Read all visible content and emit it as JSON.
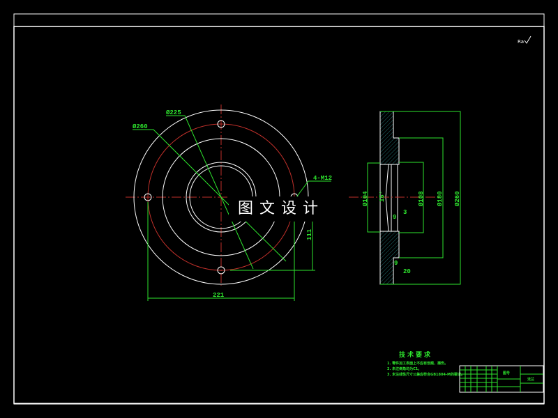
{
  "colors": {
    "background": "#000000",
    "outline": "#ffffff",
    "dimension": "#2ee62e",
    "centerline": "#c0302a"
  },
  "front_view": {
    "dims": {
      "d_outer": "Ø260",
      "d_bolt": "Ø225",
      "holes": "4-M12",
      "height": "111",
      "width": "221"
    }
  },
  "side_view": {
    "dims": {
      "d_bore": "Ø104",
      "angle": "15°",
      "d_recess": "Ø108",
      "d_step": "Ø180",
      "d_outer": "Ø260",
      "d3": "3",
      "d9a": "9",
      "d9b": "9",
      "d20": "20"
    }
  },
  "roughness_symbol": "Ra",
  "watermark": "图文设计",
  "tech_requirements": {
    "title": "技术要求",
    "lines": [
      "1. 零件加工表面上不应有划痕、擦伤。",
      "2. 未注倒角均为C1。",
      "3. 未注线性尺寸公差应符合GB1804-M的要求。"
    ]
  },
  "title_block": {
    "part_name": "法兰",
    "drawing_no": "图号"
  }
}
